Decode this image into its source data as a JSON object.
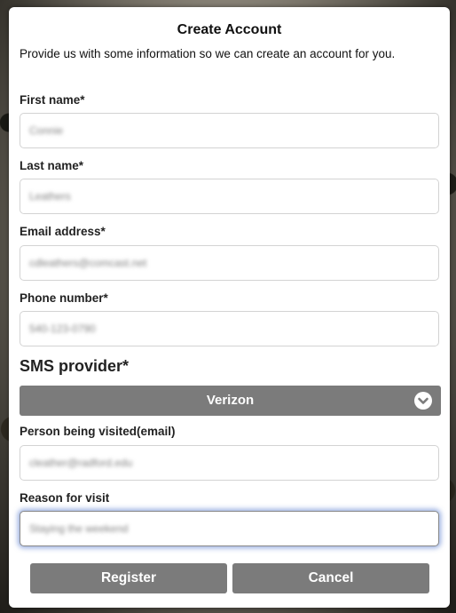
{
  "form": {
    "title": "Create Account",
    "intro": "Provide us with some information so we can create an account for you."
  },
  "fields": {
    "first_name": {
      "label": "First name*",
      "value": "Connie"
    },
    "last_name": {
      "label": "Last name*",
      "value": "Leathers"
    },
    "email": {
      "label": "Email address*",
      "value": "cdleathers@comcast.net"
    },
    "phone": {
      "label": "Phone number*",
      "value": "540-123-0790"
    },
    "sms": {
      "label": "SMS provider*",
      "selected": "Verizon"
    },
    "visited": {
      "label": "Person being visited(email)",
      "value": "cleather@radford.edu"
    },
    "reason": {
      "label": "Reason for visit",
      "value": "Staying the weekend"
    }
  },
  "buttons": {
    "register": "Register",
    "cancel": "Cancel"
  },
  "colors": {
    "button_bg": "#7b7b7b",
    "focus_glow": "#466ec8"
  }
}
